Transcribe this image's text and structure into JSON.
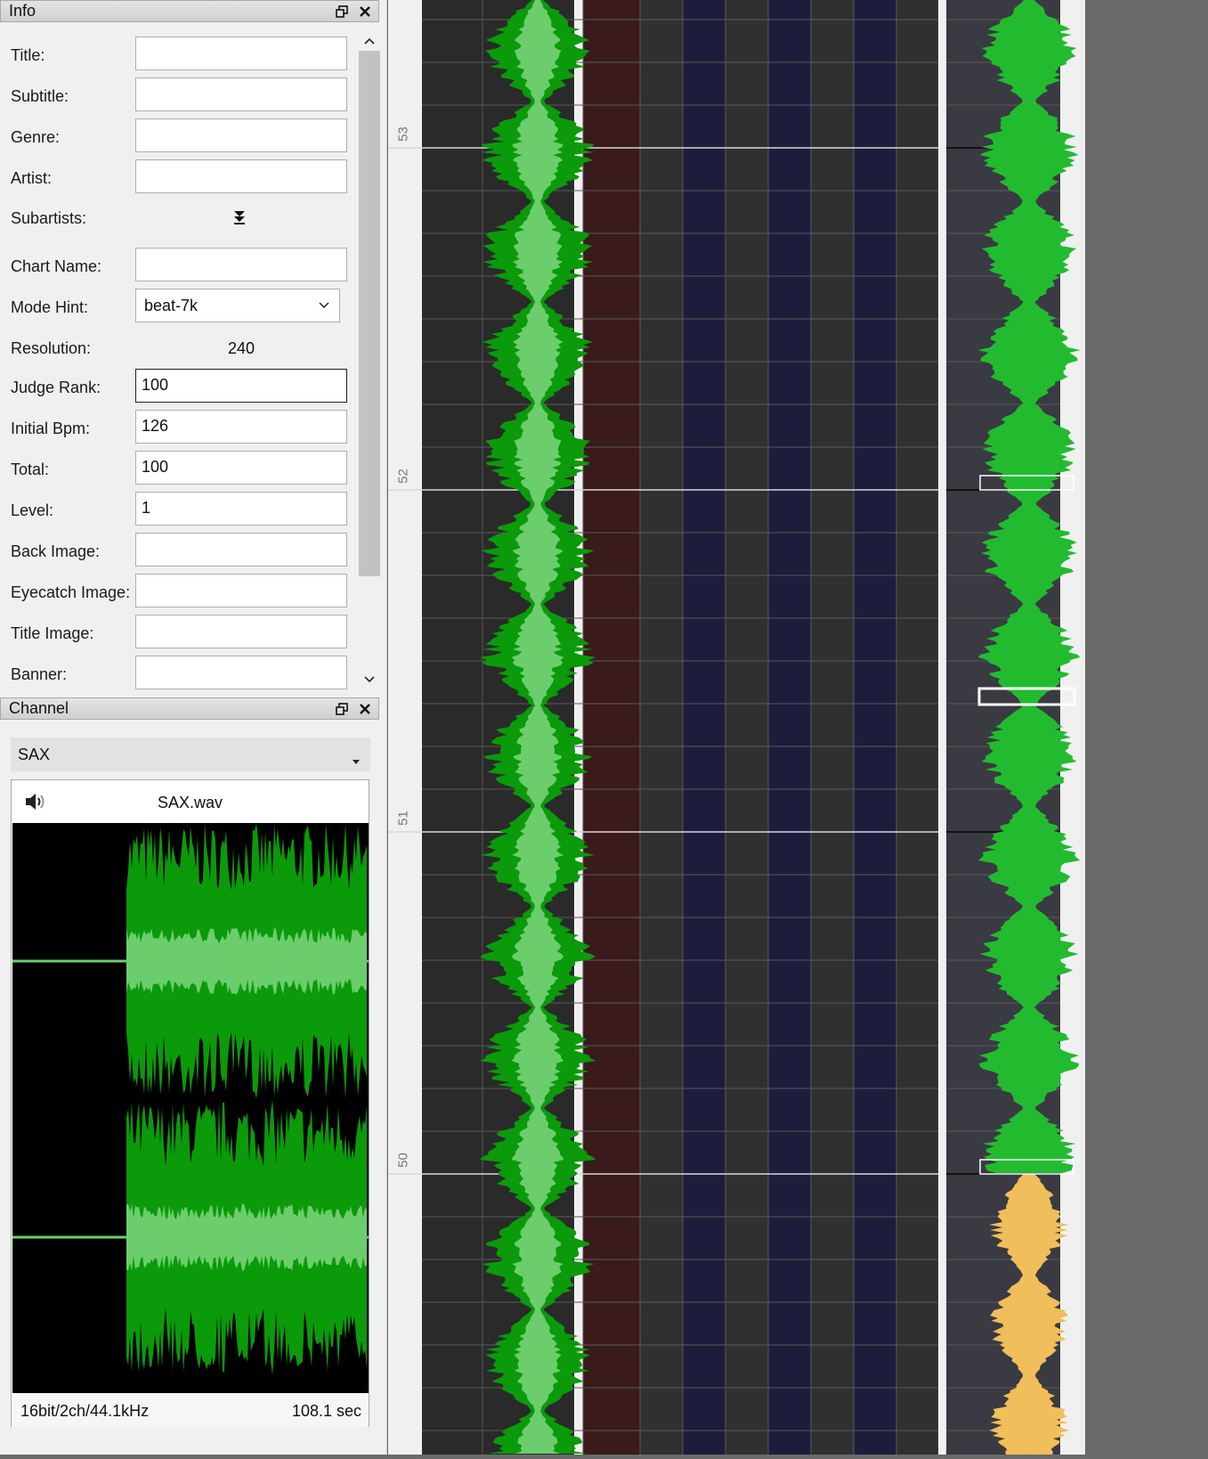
{
  "info_panel": {
    "title": "Info",
    "fields": [
      {
        "label": "Title:",
        "value": ""
      },
      {
        "label": "Subtitle:",
        "value": ""
      },
      {
        "label": "Genre:",
        "value": ""
      },
      {
        "label": "Artist:",
        "value": ""
      }
    ],
    "subartists_label": "Subartists:",
    "chart_name": {
      "label": "Chart Name:",
      "value": ""
    },
    "mode_hint": {
      "label": "Mode Hint:",
      "value": "beat-7k"
    },
    "resolution": {
      "label": "Resolution:",
      "value": "240"
    },
    "judge_rank": {
      "label": "Judge Rank:",
      "value": "100"
    },
    "initial_bpm": {
      "label": "Initial Bpm:",
      "value": "126"
    },
    "total": {
      "label": "Total:",
      "value": "100"
    },
    "level": {
      "label": "Level:",
      "value": "1"
    },
    "back_image": {
      "label": "Back Image:",
      "value": ""
    },
    "eyecatch_image": {
      "label": "Eyecatch Image:",
      "value": ""
    },
    "title_image": {
      "label": "Title Image:",
      "value": ""
    },
    "banner": {
      "label": "Banner:",
      "value": ""
    }
  },
  "channel_panel": {
    "title": "Channel",
    "selected_channel": "SAX",
    "file_name": "SAX.wav",
    "format": "16bit/2ch/44.1kHz",
    "duration": "108.1 sec"
  },
  "editor": {
    "measure_labels": [
      "53",
      "52",
      "51",
      "50"
    ]
  },
  "colors": {
    "wave_dark": "#0a9a0a",
    "wave_light": "#6ccd6c",
    "wave_mid": "#22bb30",
    "wave_orange": "#f0be5a"
  }
}
